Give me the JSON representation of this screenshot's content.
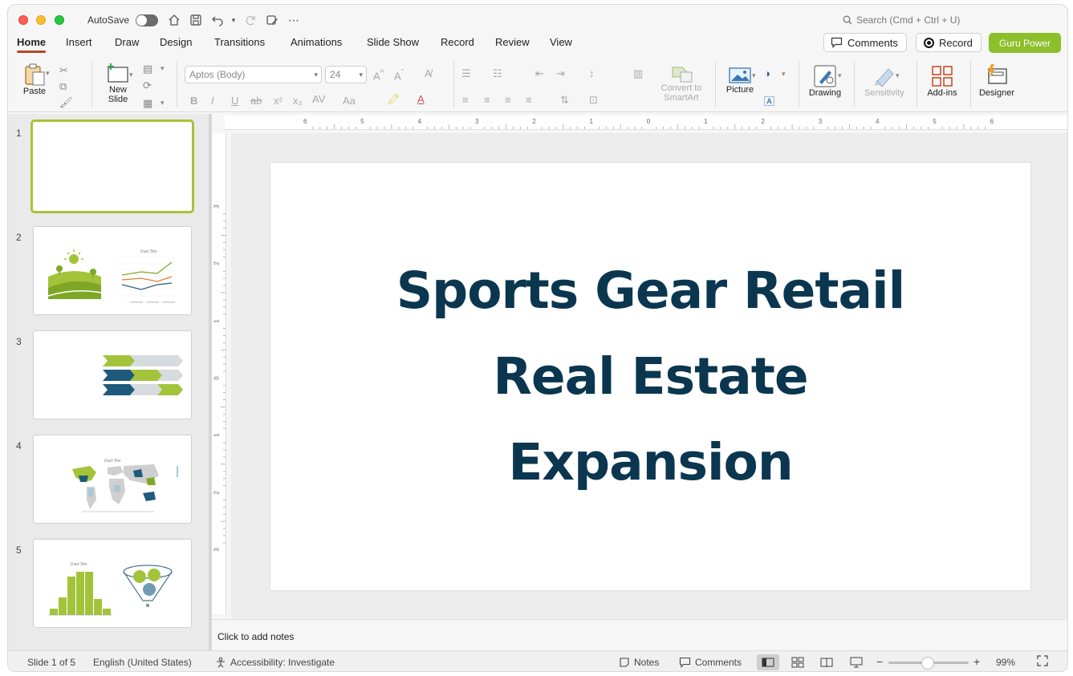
{
  "titlebar": {
    "autosave_label": "AutoSave",
    "search_placeholder": "Search (Cmd + Ctrl + U)"
  },
  "tabs": [
    {
      "label": "Home",
      "active": true
    },
    {
      "label": "Insert"
    },
    {
      "label": "Draw"
    },
    {
      "label": "Design"
    },
    {
      "label": "Transitions"
    },
    {
      "label": "Animations"
    },
    {
      "label": "Slide Show"
    },
    {
      "label": "Record"
    },
    {
      "label": "Review"
    },
    {
      "label": "View"
    }
  ],
  "actions": {
    "comments": "Comments",
    "record": "Record",
    "guru": "Guru Power"
  },
  "ribbon": {
    "paste": "Paste",
    "new_slide_1": "New",
    "new_slide_2": "Slide",
    "font_name": "Aptos (Body)",
    "font_size": "24",
    "convert_1": "Convert to",
    "convert_2": "SmartArt",
    "picture": "Picture",
    "drawing": "Drawing",
    "sensitivity": "Sensitivity",
    "addins": "Add-ins",
    "designer": "Designer"
  },
  "thumbnails": [
    {
      "num": "1",
      "chart_title": ""
    },
    {
      "num": "2",
      "chart_title": "Chart Title"
    },
    {
      "num": "3",
      "chart_title": ""
    },
    {
      "num": "4",
      "chart_title": "Chart Title"
    },
    {
      "num": "5",
      "chart_title": "Chart Title"
    }
  ],
  "slide": {
    "title_line1": "Sports Gear Retail",
    "title_line2": "Real Estate",
    "title_line3": "Expansion"
  },
  "notes_placeholder": "Click to add notes",
  "status": {
    "slide_count": "Slide 1 of 5",
    "language": "English (United States)",
    "accessibility": "Accessibility: Investigate",
    "notes": "Notes",
    "comments": "Comments",
    "zoom": "99%"
  },
  "ruler_top_labels": [
    "6",
    "5",
    "4",
    "3",
    "2",
    "1",
    "0",
    "1",
    "2",
    "3",
    "4",
    "5",
    "6"
  ],
  "ruler_left_labels": [
    "3",
    "2",
    "1",
    "0",
    "1",
    "2",
    "3"
  ],
  "colors": {
    "accent_green": "#8cbf2a",
    "title_navy": "#0b3650",
    "tab_underline": "#b7472a"
  }
}
